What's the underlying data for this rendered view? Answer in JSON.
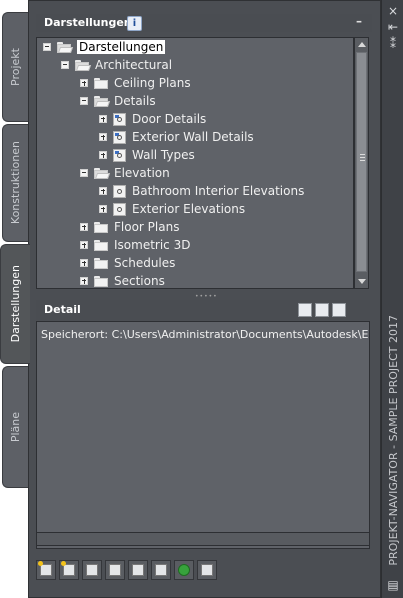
{
  "left_tabs": [
    {
      "label": "Projekt",
      "active": false
    },
    {
      "label": "Konstruktionen",
      "active": false
    },
    {
      "label": "Darstellungen",
      "active": true
    },
    {
      "label": "Pläne",
      "active": false
    }
  ],
  "right_strip": {
    "close_symbol": "×",
    "pin_symbol": "⇤",
    "settings_symbol": "⁑",
    "vertical_title": "PROJEKT-NAVIGATOR - SAMPLE PROJECT 2017",
    "bottom_symbol": "▤"
  },
  "views_panel": {
    "title": "Darstellungen",
    "info_symbol": "i",
    "minimize_symbol": "–",
    "tree": [
      {
        "label": "Darstellungen",
        "level": 0,
        "expander": "minus",
        "icon": "open-folder-icon",
        "selected": true
      },
      {
        "label": "Architectural",
        "level": 1,
        "expander": "minus",
        "icon": "open-folder-icon"
      },
      {
        "label": "Ceiling Plans",
        "level": 2,
        "expander": "plus",
        "icon": "folder-icon"
      },
      {
        "label": "Details",
        "level": 2,
        "expander": "minus",
        "icon": "open-folder-icon"
      },
      {
        "label": "Door Details",
        "level": 3,
        "expander": "plus",
        "icon": "detail-view-icon"
      },
      {
        "label": "Exterior Wall Details",
        "level": 3,
        "expander": "plus",
        "icon": "detail-view-icon"
      },
      {
        "label": "Wall Types",
        "level": 3,
        "expander": "plus",
        "icon": "detail-view-icon"
      },
      {
        "label": "Elevation",
        "level": 2,
        "expander": "minus",
        "icon": "open-folder-icon"
      },
      {
        "label": "Bathroom Interior Elevations",
        "level": 3,
        "expander": "plus",
        "icon": "elevation-view-icon"
      },
      {
        "label": "Exterior Elevations",
        "level": 3,
        "expander": "plus",
        "icon": "elevation-view-icon"
      },
      {
        "label": "Floor Plans",
        "level": 2,
        "expander": "plus",
        "icon": "folder-icon"
      },
      {
        "label": "Isometric 3D",
        "level": 2,
        "expander": "plus",
        "icon": "folder-icon"
      },
      {
        "label": "Schedules",
        "level": 2,
        "expander": "plus",
        "icon": "folder-icon"
      },
      {
        "label": "Sections",
        "level": 2,
        "expander": "plus",
        "icon": "folder-icon"
      }
    ]
  },
  "detail_panel": {
    "title": "Detail",
    "text": "Speicherort: C:\\Users\\Administrator\\Documents\\Autodesk\\Eig",
    "buttons": [
      "detail-preview-icon",
      "detail-list-icon",
      "detail-thumbnail-icon"
    ]
  },
  "toolbar": {
    "buttons": [
      "new-view-icon",
      "new-category-icon",
      "regenerate-icon",
      "clipboard-icon",
      "open-xref-icon",
      "properties-icon",
      "refresh-icon",
      "print-icon"
    ]
  },
  "colors": {
    "panel_background": "#4b4e53",
    "tree_background": "#5f6268",
    "selection_background": "#ffffff"
  }
}
